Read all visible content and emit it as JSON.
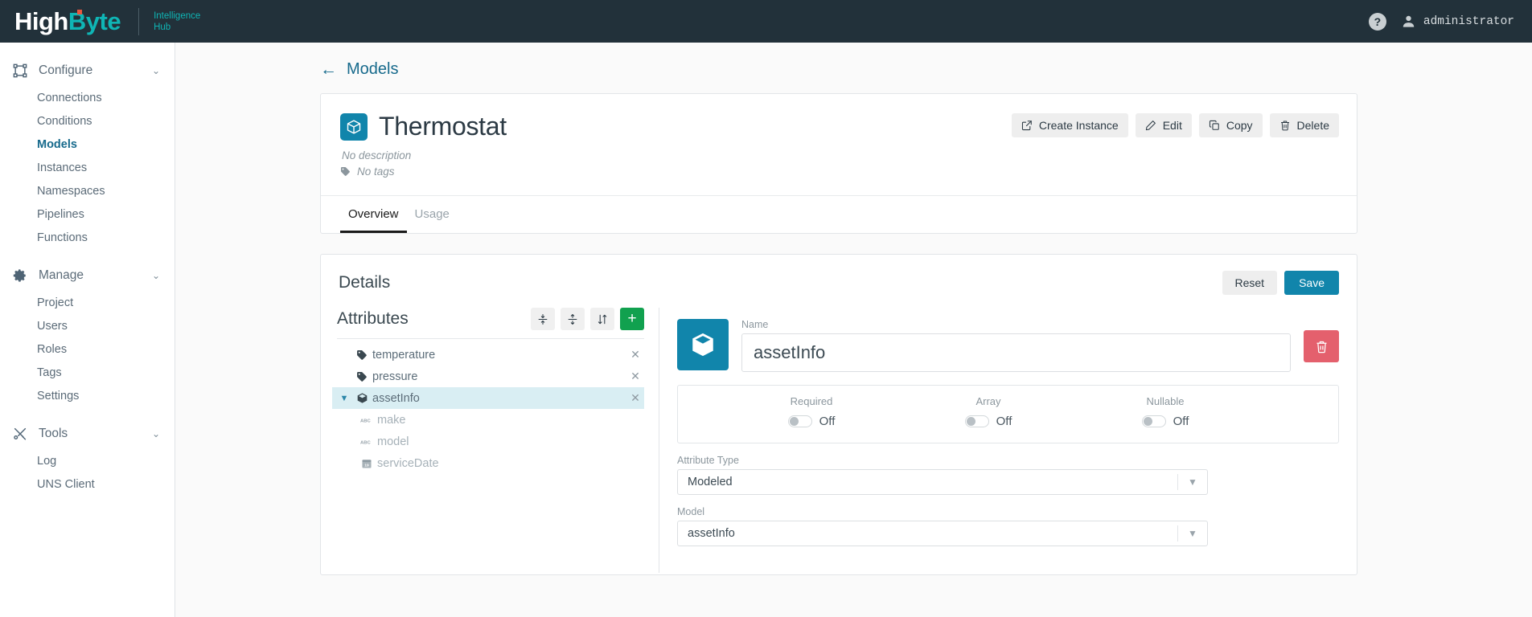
{
  "topbar": {
    "brand_high": "High",
    "brand_byte": "Byte",
    "product_line1": "Intelligence",
    "product_line2": "Hub",
    "help_label": "?",
    "user_name": "administrator"
  },
  "sidebar": {
    "groups": [
      {
        "label": "Configure",
        "icon": "configure-icon",
        "chevron": "⌄",
        "items": [
          {
            "label": "Connections",
            "active": false
          },
          {
            "label": "Conditions",
            "active": false
          },
          {
            "label": "Models",
            "active": true
          },
          {
            "label": "Instances",
            "active": false
          },
          {
            "label": "Namespaces",
            "active": false
          },
          {
            "label": "Pipelines",
            "active": false
          },
          {
            "label": "Functions",
            "active": false
          }
        ]
      },
      {
        "label": "Manage",
        "icon": "gear-icon",
        "chevron": "⌄",
        "items": [
          {
            "label": "Project",
            "active": false
          },
          {
            "label": "Users",
            "active": false
          },
          {
            "label": "Roles",
            "active": false
          },
          {
            "label": "Tags",
            "active": false
          },
          {
            "label": "Settings",
            "active": false
          }
        ]
      },
      {
        "label": "Tools",
        "icon": "tools-icon",
        "chevron": "⌄",
        "items": [
          {
            "label": "Log",
            "active": false
          },
          {
            "label": "UNS Client",
            "active": false
          }
        ]
      }
    ]
  },
  "breadcrumb": {
    "back_arrow": "←",
    "label": "Models"
  },
  "model_card": {
    "title": "Thermostat",
    "description": "No description",
    "tags": "No tags",
    "actions": [
      {
        "label": "Create Instance",
        "icon": "external-link-icon"
      },
      {
        "label": "Edit",
        "icon": "pencil-icon"
      },
      {
        "label": "Copy",
        "icon": "copy-icon"
      },
      {
        "label": "Delete",
        "icon": "trash-icon"
      }
    ],
    "tabs": [
      {
        "label": "Overview",
        "active": true
      },
      {
        "label": "Usage",
        "active": false
      }
    ]
  },
  "details": {
    "title": "Details",
    "reset_label": "Reset",
    "save_label": "Save",
    "attributes": {
      "title": "Attributes",
      "toolbar": [
        {
          "name": "collapse-all-button",
          "glyph": "collapse"
        },
        {
          "name": "expand-all-button",
          "glyph": "expand"
        },
        {
          "name": "sort-button",
          "glyph": "sort"
        },
        {
          "name": "add-attribute-button",
          "glyph": "+"
        }
      ],
      "items": [
        {
          "label": "temperature",
          "icon": "tag-icon",
          "level": 0,
          "selected": false,
          "expandable": false,
          "removable": true
        },
        {
          "label": "pressure",
          "icon": "tag-icon",
          "level": 0,
          "selected": false,
          "expandable": false,
          "removable": true
        },
        {
          "label": "assetInfo",
          "icon": "cube-icon",
          "level": 0,
          "selected": true,
          "expandable": true,
          "expanded": true,
          "removable": true
        },
        {
          "label": "make",
          "icon": "abc-icon",
          "level": 1,
          "selected": false,
          "expandable": false,
          "removable": false
        },
        {
          "label": "model",
          "icon": "abc-icon",
          "level": 1,
          "selected": false,
          "expandable": false,
          "removable": false
        },
        {
          "label": "serviceDate",
          "icon": "calendar-icon",
          "level": 1,
          "selected": false,
          "expandable": false,
          "removable": false
        }
      ]
    },
    "editor": {
      "badge_icon": "cube-icon",
      "name_label": "Name",
      "name_value": "assetInfo",
      "delete_icon": "trash-icon",
      "toggles": [
        {
          "label": "Required",
          "state": "Off",
          "on": false
        },
        {
          "label": "Array",
          "state": "Off",
          "on": false
        },
        {
          "label": "Nullable",
          "state": "Off",
          "on": false
        }
      ],
      "attribute_type_label": "Attribute Type",
      "attribute_type_value": "Modeled",
      "model_label": "Model",
      "model_value": "assetInfo"
    }
  },
  "colors": {
    "topbar_bg": "#22313a",
    "brand_teal": "#0fb5b5",
    "accent_blue": "#176a8c",
    "badge_blue": "#1185ab",
    "add_green": "#11a14f",
    "delete_red": "#e4606d",
    "selected_row": "#d9eef3"
  }
}
